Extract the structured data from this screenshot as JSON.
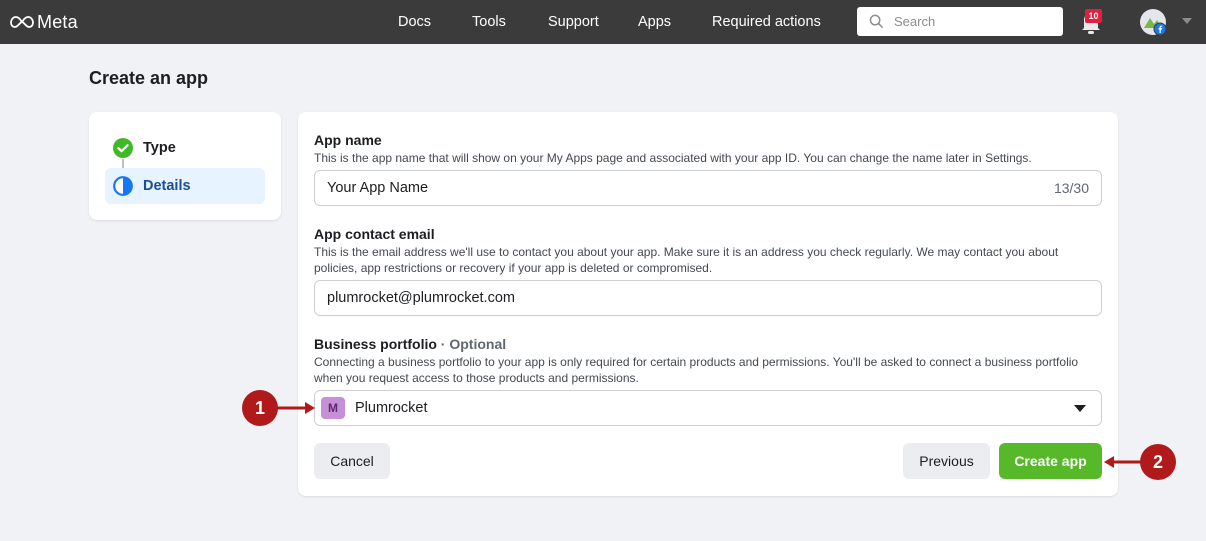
{
  "header": {
    "logo_text": "Meta",
    "nav": [
      "Docs",
      "Tools",
      "Support",
      "Apps",
      "Required actions"
    ],
    "search_placeholder": "Search",
    "notifications_count": "10"
  },
  "page": {
    "title": "Create an app"
  },
  "steps": [
    {
      "label": "Type",
      "state": "complete"
    },
    {
      "label": "Details",
      "state": "current"
    }
  ],
  "form": {
    "app_name": {
      "label": "App name",
      "help": "This is the app name that will show on your My Apps page and associated with your app ID. You can change the name later in Settings.",
      "value": "Your App Name",
      "counter": "13/30"
    },
    "contact_email": {
      "label": "App contact email",
      "help": "This is the email address we'll use to contact you about your app. Make sure it is an address you check regularly. We may contact you about policies, app restrictions or recovery if your app is deleted or compromised.",
      "value": "plumrocket@plumrocket.com"
    },
    "business_portfolio": {
      "label": "Business portfolio",
      "optional": "· Optional",
      "help": "Connecting a business portfolio to your app is only required for certain products and permissions. You'll be asked to connect a business portfolio when you request access to those products and permissions.",
      "badge": "M",
      "value": "Plumrocket"
    },
    "buttons": {
      "cancel": "Cancel",
      "previous": "Previous",
      "create": "Create app"
    }
  },
  "annotations": [
    "1",
    "2"
  ],
  "colors": {
    "accent_green": "#57b82a",
    "callout_red": "#b01a1a",
    "topbar": "#3b3b3b"
  }
}
